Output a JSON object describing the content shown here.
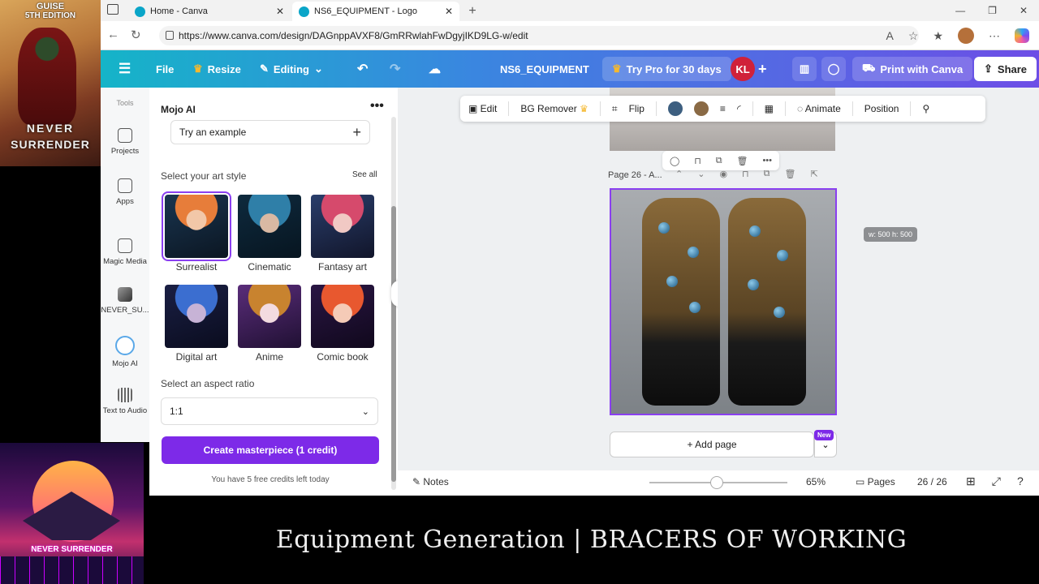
{
  "overlay": {
    "poster_line1": "GUISE",
    "poster_line2": "5TH EDITION",
    "poster_title1": "NEVER",
    "poster_title2": "SURRENDER",
    "synth_text": "NEVER SURRENDER"
  },
  "browser": {
    "tabs": [
      {
        "title": "Home - Canva"
      },
      {
        "title": "NS6_EQUIPMENT - Logo"
      }
    ],
    "new_tab": "+",
    "close": "✕",
    "win_controls": [
      "—",
      "❐",
      "✕"
    ],
    "url": "https://www.canva.com/design/DAGnppAVXF8/GmRRwlahFwDgyjIKD9LG-w/edit"
  },
  "canva": {
    "menu": "☰",
    "file": "File",
    "resize": "Resize",
    "editing": "Editing",
    "doc_title": "NS6_EQUIPMENT",
    "try_pro": "Try Pro for 30 days",
    "avatar": "KL",
    "print": "Print with Canva",
    "share": "Share"
  },
  "rail": {
    "tools": "Tools",
    "projects": "Projects",
    "apps": "Apps",
    "magic_media": "Magic Media",
    "never_su": "NEVER_SU...",
    "mojo_ai": "Mojo AI",
    "text_to_audio": "Text to Audio"
  },
  "panel": {
    "title": "Mojo AI",
    "more": "•••",
    "try_example": "Try an example",
    "style_label": "Select your art style",
    "see_all": "See all",
    "styles": [
      "Surrealist",
      "Cinematic",
      "Fantasy art",
      "Digital art",
      "Anime",
      "Comic book"
    ],
    "selected_style": "Surrealist",
    "ratio_label": "Select an aspect ratio",
    "ratio_value": "1:1",
    "create_button": "Create masterpiece (1 credit)",
    "credits_note": "You have 5 free credits left today"
  },
  "toolbar": {
    "edit": "Edit",
    "bg_remover": "BG Remover",
    "flip": "Flip",
    "animate": "Animate",
    "position": "Position",
    "swatches": [
      "#3d5f80",
      "#8a6a45"
    ]
  },
  "canvas": {
    "page_label": "Page 26 - A...",
    "dim_tip": "w: 500 h: 500",
    "add_page": "+ Add page",
    "new_badge": "New"
  },
  "status": {
    "notes": "Notes",
    "zoom": "65%",
    "pages": "Pages",
    "page_count": "26 / 26",
    "zoom_fraction": 0.49
  },
  "caption": "Equipment Generation | BRACERS OF WORKING"
}
